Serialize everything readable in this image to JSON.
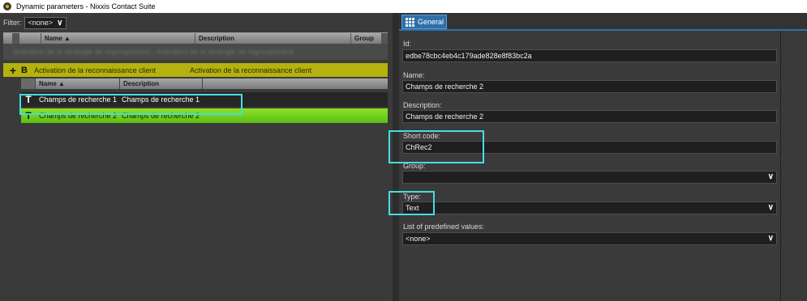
{
  "window": {
    "title": "Dynamic parameters - Nixxis Contact Suite"
  },
  "filter": {
    "label": "Filter:",
    "value": "<none>"
  },
  "grid": {
    "columns": [
      "Name ▲",
      "Description",
      "Group"
    ],
    "group_row": {
      "marker": "B",
      "name": "Activation de la reconnaissance client",
      "description": "Activation de la reconnaissance client"
    },
    "sub_columns": [
      "Name ▲",
      "Description"
    ],
    "rows": [
      {
        "type": "T",
        "name": "Champs de recherche 1",
        "description": "Champs de recherche 1"
      },
      {
        "type": "T",
        "name": "Champs de recherche 2",
        "description": "Champs de recherche 2"
      }
    ],
    "dim_row_text": "Activation de la strategie de regroupement - Activation de la strategie de regroupement"
  },
  "tabs": [
    {
      "label": "General"
    }
  ],
  "form": {
    "id_label": "Id:",
    "id_value": "edbe78cbc4eb4c179ade828e8f83bc2a",
    "name_label": "Name:",
    "name_value": "Champs de recherche 2",
    "description_label": "Description:",
    "description_value": "Champs de recherche 2",
    "short_code_label": "Short code:",
    "short_code_value": "ChRec2",
    "group_label": "Group:",
    "group_value": "",
    "type_label": "Type:",
    "type_value": "Text",
    "predefined_label": "List of predefined values:",
    "predefined_value": "<none>"
  },
  "colors": {
    "highlight": "#46dde0",
    "group_row": "#b5b20f",
    "selected_row": "#6cc81b",
    "tab": "#2f6fa8"
  }
}
